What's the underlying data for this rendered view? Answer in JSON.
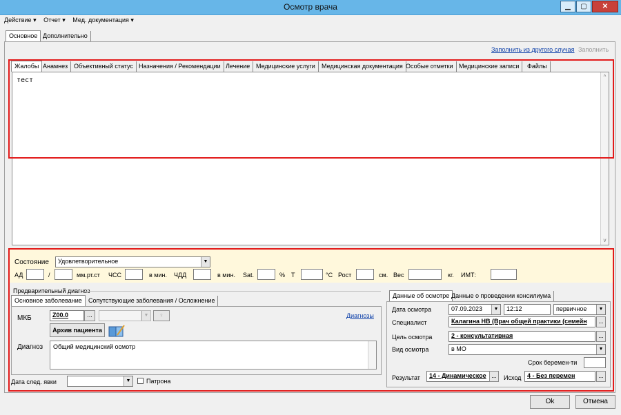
{
  "window": {
    "title": "Осмотр врача",
    "min": "▁",
    "max": "▢",
    "close": "✕"
  },
  "menu": [
    "Действие ▾",
    "Отчет ▾",
    "Мед. документация ▾"
  ],
  "top_tabs": [
    "Основное",
    "Дополнительно"
  ],
  "links": {
    "fill_other": "Заполнить из другого случая",
    "fill": "Заполнить"
  },
  "content_tabs": [
    "Жалобы",
    "Анамнез",
    "Объективный статус",
    "Назначения / Рекомендации",
    "Лечение",
    "Медицинские услуги",
    "Медицинская документация",
    "Особые отметки",
    "Медицинские записи",
    "Файлы"
  ],
  "complaints_text": "тест",
  "vitals": {
    "state_label": "Состояние",
    "state_value": "Удовлетворительное",
    "ad": "АД",
    "slash": "/",
    "mmhg": "мм.рт.ст",
    "chss": "ЧСС",
    "permin1": "в мин.",
    "chdd": "ЧДД",
    "permin2": "в мин.",
    "sat": "Sat.",
    "pct": "%",
    "t": "T",
    "deg": "°С",
    "rost": "Рост",
    "cm": "см.",
    "ves": "Вес",
    "kg": "кг.",
    "imt": "ИМТ:"
  },
  "diag": {
    "group": "Предварительный диагноз",
    "tabs": [
      "Основное заболевание",
      "Сопутствующие заболевания / Осложнение"
    ],
    "mkb_label": "МКБ",
    "mkb_value": "Z00.0",
    "diagnoses_link": "Диагнозы",
    "archive": "Архив пациента",
    "diag_label": "Диагноз",
    "diag_value": "Общий медицинский осмотр",
    "next_visit": "Дата след. явки",
    "patronage": "Патрона"
  },
  "exam": {
    "tabs": [
      "Данные об осмотре",
      "Данные о проведении консилиума"
    ],
    "date_label": "Дата осмотра",
    "date": "07.09.2023",
    "time": "12:12",
    "kind": "первичное",
    "spec_label": "Специалист",
    "spec": "Калагина НВ (Врач общей практики (семейн",
    "goal_label": "Цель осмотра",
    "goal": "2 - консультативная",
    "type_label": "Вид осмотра",
    "type": "в МО",
    "preg_label": "Срок беремен-ти",
    "result_label": "Результат",
    "result": "14 - Динамическое",
    "outcome_label": "Исход",
    "outcome": "4 - Без перемен"
  },
  "buttons": {
    "ok": "Ok",
    "cancel": "Отмена"
  },
  "ellipsis": "..."
}
